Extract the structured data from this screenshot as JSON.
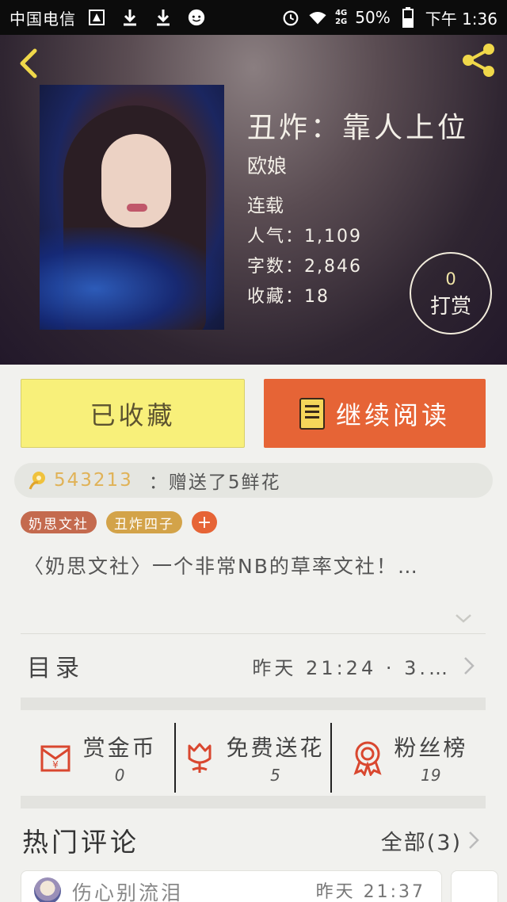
{
  "status_bar": {
    "carrier": "中国电信",
    "network_top": "4G",
    "network_bottom": "2G",
    "battery": "50%",
    "time": "下午 1:36"
  },
  "book": {
    "title": "丑炸：靠人上位",
    "author": "欧娘",
    "status": "连载",
    "popularity": "人气：1,109",
    "word_count": "字数：2,846",
    "favorites": "收藏：18"
  },
  "reward": {
    "count": "0",
    "label": "打赏"
  },
  "actions": {
    "favorite_label": "已收藏",
    "read_label": "继续阅读"
  },
  "gift_notice": {
    "user": "543213",
    "text": "：赠送了5鲜花"
  },
  "tags": [
    "奶思文社",
    "丑炸四子"
  ],
  "tag_add": "+",
  "description": "〈奶思文社〉一个非常NB的草率文社！…",
  "catalog": {
    "label": "目录",
    "latest": "昨天 21:24 · 3.…"
  },
  "stats": [
    {
      "label": "赏金币",
      "value": "0",
      "icon": "red-envelope-icon"
    },
    {
      "label": "免费送花",
      "value": "5",
      "icon": "flower-icon"
    },
    {
      "label": "粉丝榜",
      "value": "19",
      "icon": "medal-icon"
    }
  ],
  "comments": {
    "title": "热门评论",
    "all_label": "全部(3)",
    "items": [
      {
        "user": "伤心别流泪",
        "time": "昨天 21:37"
      }
    ]
  },
  "colors": {
    "accent_orange": "#e66436",
    "favorite_yellow": "#f8f07a",
    "gift_gold": "#e0b257",
    "icon_red": "#d9472f"
  }
}
